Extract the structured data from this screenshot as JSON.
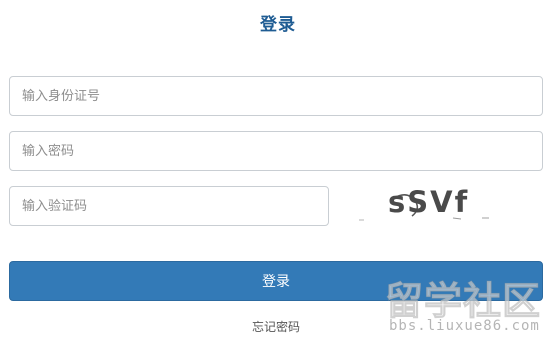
{
  "page": {
    "title": "登录"
  },
  "form": {
    "id_placeholder": "输入身份证号",
    "password_placeholder": "输入密码",
    "captcha_placeholder": "输入验证码",
    "captcha_text": "sSVf",
    "submit_label": "登录",
    "forgot_label": "忘记密码"
  },
  "watermark": {
    "main": "留学社区",
    "sub": "bbs.liuxue86.com"
  },
  "colors": {
    "title": "#1f5c93",
    "primary_button": "#337ab7",
    "input_border": "#c9ced3"
  }
}
